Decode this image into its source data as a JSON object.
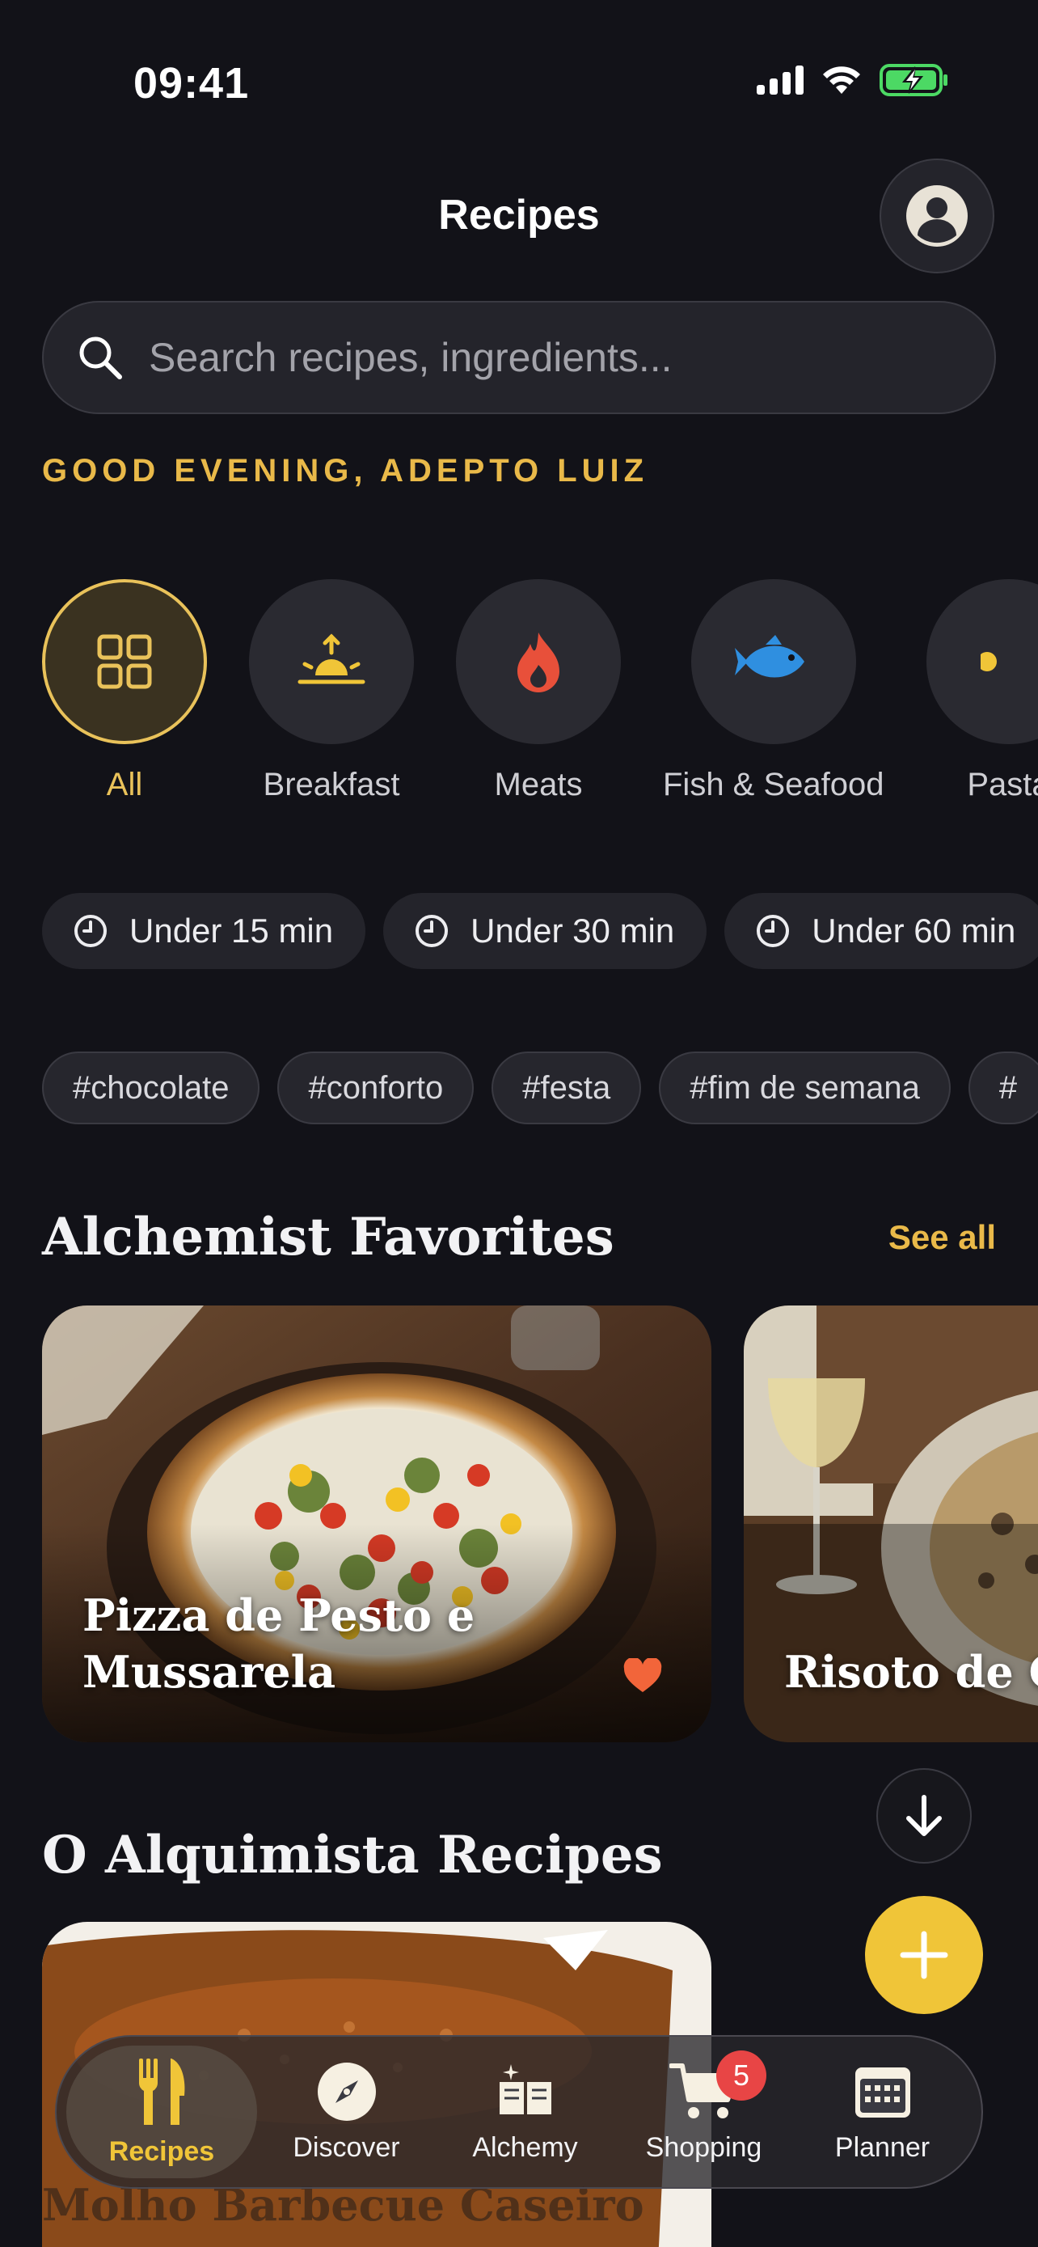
{
  "status_bar": {
    "time": "09:41"
  },
  "header": {
    "title": "Recipes"
  },
  "search": {
    "placeholder": "Search recipes, ingredients..."
  },
  "greeting": "GOOD EVENING, ADEPTO LUIZ",
  "categories": [
    {
      "label": "All",
      "icon": "grid-icon",
      "active": true
    },
    {
      "label": "Breakfast",
      "icon": "sunrise-icon"
    },
    {
      "label": "Meats",
      "icon": "flame-icon"
    },
    {
      "label": "Fish & Seafood",
      "icon": "fish-icon"
    },
    {
      "label": "Pasta",
      "icon": "pasta-icon"
    }
  ],
  "time_filters": [
    "Under 15 min",
    "Under 30 min",
    "Under 60 min"
  ],
  "tags": [
    "#chocolate",
    "#conforto",
    "#festa",
    "#fim de semana",
    "#"
  ],
  "favorites": {
    "title": "Alchemist Favorites",
    "see_all": "See all",
    "cards": [
      {
        "title": "Pizza de Pesto e Mussarela",
        "favorited": true
      },
      {
        "title": "Risoto de C"
      }
    ]
  },
  "recipes_section": {
    "title": "O Alquimista Recipes",
    "cards": [
      {
        "title": "Molho Barbecue Caseiro"
      }
    ]
  },
  "tabs": [
    {
      "label": "Recipes",
      "icon": "fork-knife-icon",
      "active": true
    },
    {
      "label": "Discover",
      "icon": "compass-icon"
    },
    {
      "label": "Alchemy",
      "icon": "book-sparkle-icon"
    },
    {
      "label": "Shopping",
      "icon": "cart-icon",
      "badge": "5"
    },
    {
      "label": "Planner",
      "icon": "calendar-icon"
    }
  ],
  "colors": {
    "accent": "#f0c538",
    "background": "#121218",
    "badge": "#e84545"
  }
}
